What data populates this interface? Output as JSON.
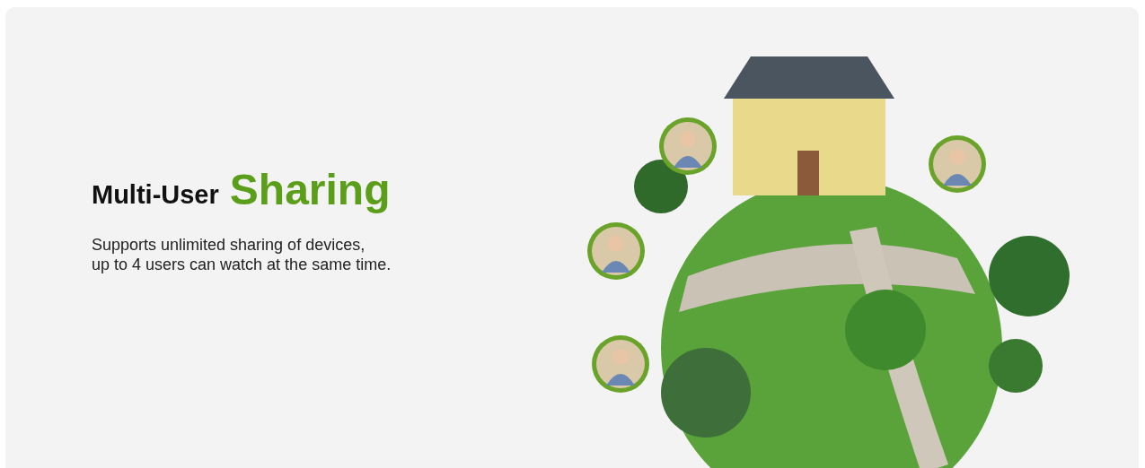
{
  "heading": {
    "lead": "Multi-User",
    "highlight": "Sharing"
  },
  "description": [
    "Supports unlimited sharing of devices,",
    "up to 4 users can watch at the same time."
  ]
}
